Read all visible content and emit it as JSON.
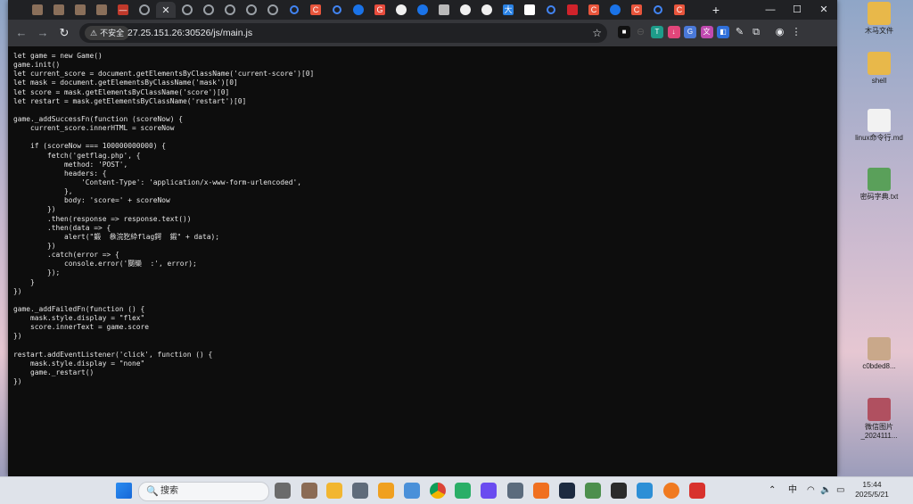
{
  "desktop": {
    "icons": [
      {
        "label": "木马文件",
        "color": "#e8b84a"
      },
      {
        "label": "shell",
        "color": "#e8b84a"
      },
      {
        "label": "linux命令行.md",
        "color": "#f2f2f2"
      },
      {
        "label": "密码字典.txt",
        "color": "#5aa05a"
      },
      {
        "label": "c0bded8...",
        "color": "#c9a88a"
      },
      {
        "label": "微信图片_2024111...",
        "color": "#b05060"
      }
    ]
  },
  "browser": {
    "tab_close_glyph": "✕",
    "new_tab_glyph": "+",
    "window_controls": {
      "minimize": "—",
      "restore": "☐",
      "close": "✕"
    },
    "nav": {
      "back": "←",
      "forward": "→",
      "reload": "↻"
    },
    "security_label": "不安全",
    "url": "27.25.151.26:30526/js/main.js",
    "star_glyph": "☆",
    "tabs": [
      {
        "icon": "image-icon",
        "color": "#8a6f5a",
        "glyph": ""
      },
      {
        "icon": "image-icon",
        "color": "#8a6f5a",
        "glyph": ""
      },
      {
        "icon": "image-icon",
        "color": "#8a6f5a",
        "glyph": ""
      },
      {
        "icon": "image-icon",
        "color": "#8a6f5a",
        "glyph": ""
      },
      {
        "icon": "dash-icon",
        "color": "#c0392b",
        "glyph": "—"
      },
      {
        "icon": "globe-icon",
        "color": "#9aa0a6",
        "glyph": ""
      },
      {
        "icon": "close-icon",
        "color": "#35363a",
        "glyph": ""
      },
      {
        "icon": "globe-icon",
        "color": "#9aa0a6",
        "glyph": ""
      },
      {
        "icon": "globe-icon",
        "color": "#9aa0a6",
        "glyph": ""
      },
      {
        "icon": "globe-icon",
        "color": "#9aa0a6",
        "glyph": ""
      },
      {
        "icon": "globe-icon",
        "color": "#9aa0a6",
        "glyph": ""
      },
      {
        "icon": "globe-icon",
        "color": "#9aa0a6",
        "glyph": ""
      },
      {
        "icon": "search-icon",
        "color": "#4285f4",
        "glyph": ""
      },
      {
        "icon": "csdn-icon",
        "color": "#e8553c",
        "glyph": "C"
      },
      {
        "icon": "search-icon",
        "color": "#4285f4",
        "glyph": ""
      },
      {
        "icon": "circle-icon",
        "color": "#1a73e8",
        "glyph": ""
      },
      {
        "icon": "g-icon",
        "color": "#e84c3d",
        "glyph": "G"
      },
      {
        "icon": "github-icon",
        "color": "#f0f0f0",
        "glyph": ""
      },
      {
        "icon": "circle-icon",
        "color": "#1a73e8",
        "glyph": ""
      },
      {
        "icon": "photo-icon",
        "color": "#b9b9b9",
        "glyph": ""
      },
      {
        "icon": "github-icon",
        "color": "#f0f0f0",
        "glyph": ""
      },
      {
        "icon": "github-icon",
        "color": "#f0f0f0",
        "glyph": ""
      },
      {
        "icon": "translate-icon",
        "color": "#2a82e4",
        "glyph": "大"
      },
      {
        "icon": "google-icon",
        "color": "#ffffff",
        "glyph": "G"
      },
      {
        "icon": "search-icon",
        "color": "#4285f4",
        "glyph": ""
      },
      {
        "icon": "huawei-icon",
        "color": "#d0232b",
        "glyph": ""
      },
      {
        "icon": "csdn-icon",
        "color": "#e8553c",
        "glyph": "C"
      },
      {
        "icon": "circle-icon",
        "color": "#1a73e8",
        "glyph": ""
      },
      {
        "icon": "csdn-icon",
        "color": "#e8553c",
        "glyph": "C"
      },
      {
        "icon": "search-icon",
        "color": "#4285f4",
        "glyph": ""
      },
      {
        "icon": "csdn-icon",
        "color": "#e8553c",
        "glyph": "C"
      }
    ],
    "extensions": [
      {
        "icon": "ext-dark-icon",
        "color": "#111111",
        "glyph": "■"
      },
      {
        "icon": "ext-minus-icon",
        "color": "#555555",
        "glyph": "⊖"
      },
      {
        "icon": "ext-t-icon",
        "color": "#1e9c8a",
        "glyph": "T"
      },
      {
        "icon": "ext-download-icon",
        "color": "#e2467a",
        "glyph": "↓"
      },
      {
        "icon": "ext-translate-icon",
        "color": "#4a79d8",
        "glyph": "G"
      },
      {
        "icon": "ext-pink-icon",
        "color": "#c04ab0",
        "glyph": "文"
      },
      {
        "icon": "ext-blue-icon",
        "color": "#2f6fda",
        "glyph": "◧"
      },
      {
        "icon": "ext-pen-icon",
        "color": "#e8eaed",
        "glyph": "✎"
      },
      {
        "icon": "extensions-icon",
        "color": "#e8eaed",
        "glyph": "⧉"
      },
      {
        "icon": "profile-icon",
        "color": "#e8eaed",
        "glyph": "◉"
      },
      {
        "icon": "menu-icon",
        "color": "#e8eaed",
        "glyph": "⋮"
      }
    ]
  },
  "page": {
    "code_lines": [
      "let game = new Game()",
      "game.init()",
      "let current_score = document.getElementsByClassName('current-score')[0]",
      "let mask = document.getElementsByClassName('mask')[0]",
      "let score = mask.getElementsByClassName('score')[0]",
      "let restart = mask.getElementsByClassName('restart')[0]",
      "",
      "game._addSuccessFn(function (scoreNow) {",
      "    current_score.innerHTML = scoreNow",
      "",
      "    if (scoreNow === 100000000000) {",
      "        fetch('getflag.php', {",
      "            method: 'POST',",
      "            headers: {",
      "                'Content-Type': 'application/x-www-form-urlencoded',",
      "            },",
      "            body: 'score=' + scoreNow",
      "        })",
      "        .then(response => response.text())",
      "        .then(data => {",
      "            alert(\"鍛  叅浣犵紣flag鍔  鍜\" + data);",
      "        })",
      "        .catch(error => {",
      "            console.error('閿欒  :', error);",
      "        });",
      "    }",
      "})",
      "",
      "game._addFailedFn(function () {",
      "    mask.style.display = \"flex\"",
      "    score.innerText = game.score",
      "})",
      "",
      "restart.addEventListener('click', function () {",
      "    mask.style.display = \"none\"",
      "    game._restart()",
      "})"
    ]
  },
  "taskbar": {
    "search_placeholder": "搜索",
    "search_glyph": "🔍",
    "apps": [
      {
        "icon": "start-icon",
        "color": "#1f7ae0"
      },
      {
        "icon": "task-view-icon",
        "color": "#6b6b6b"
      },
      {
        "icon": "avatar-app-icon",
        "color": "#8b6b55"
      },
      {
        "icon": "file-explorer-icon",
        "color": "#f2b630"
      },
      {
        "icon": "settings-icon",
        "color": "#5f6b7a"
      },
      {
        "icon": "shield-app-icon",
        "color": "#f0a020"
      },
      {
        "icon": "network-app-icon",
        "color": "#4a90d9"
      },
      {
        "icon": "chrome-icon",
        "color": "#e0433a"
      },
      {
        "icon": "wechat-icon",
        "color": "#2aae67"
      },
      {
        "icon": "bolt-app-icon",
        "color": "#6a4cf0"
      },
      {
        "icon": "screenshot-app-icon",
        "color": "#5b6b7d"
      },
      {
        "icon": "burp-icon",
        "color": "#f07020"
      },
      {
        "icon": "dark-app-icon",
        "color": "#1c2a40"
      },
      {
        "icon": "image-app-icon",
        "color": "#4d8f4d"
      },
      {
        "icon": "terminal-icon",
        "color": "#2b2b2b"
      },
      {
        "icon": "notes-app-icon",
        "color": "#2d8fd6"
      },
      {
        "icon": "firefox-icon",
        "color": "#f07a20"
      },
      {
        "icon": "wps-icon",
        "color": "#d8322d"
      }
    ],
    "tray": {
      "chevron": "⌃",
      "ime": "中",
      "wifi": "◠",
      "volume": "🔈",
      "battery": "▭",
      "time": "15:44",
      "date": "2025/5/21"
    }
  }
}
